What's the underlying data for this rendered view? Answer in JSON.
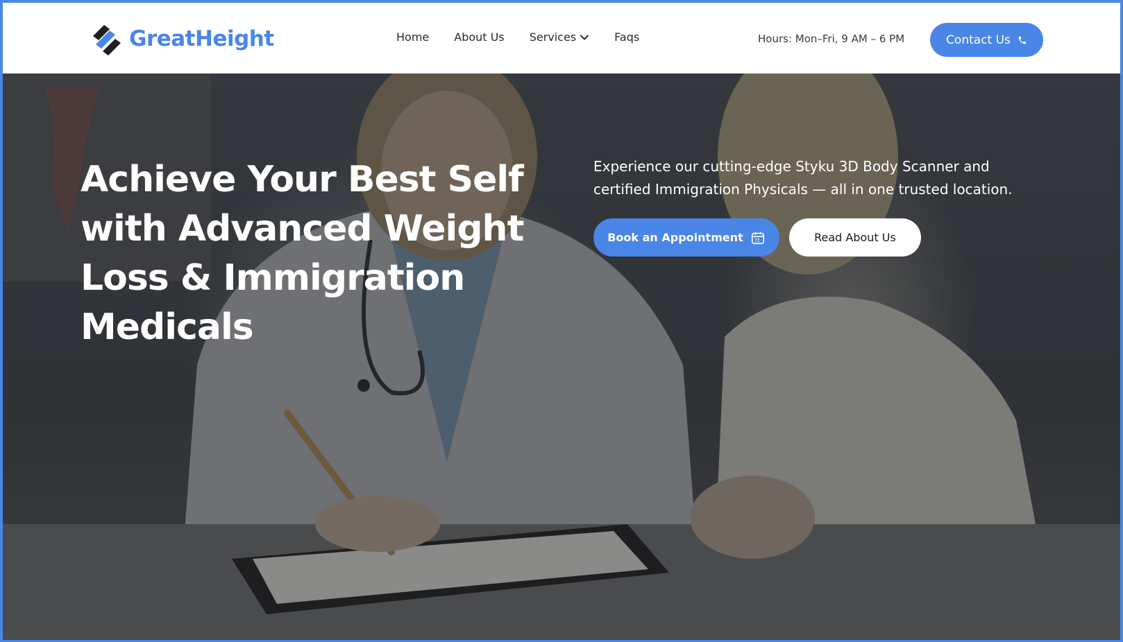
{
  "brand": {
    "name": "GreatHeight",
    "logo_icon": "greatheight-logo-icon",
    "colors": {
      "accent": "#4a86e8",
      "dark": "#1f1f1f"
    }
  },
  "nav": {
    "items": [
      {
        "label": "Home"
      },
      {
        "label": "About Us"
      },
      {
        "label": "Services",
        "icon": "chevron-down-icon"
      },
      {
        "label": "Faqs"
      }
    ]
  },
  "header": {
    "hours": "Hours: Mon–Fri, 9 AM – 6 PM",
    "contact_label": "Contact Us",
    "contact_icon": "phone-icon"
  },
  "hero": {
    "title": "Achieve Your Best Self with Advanced Weight Loss & Immigration Medicals",
    "subtitle": "Experience our cutting-edge Styku 3D Body Scanner and certified Immigration Physicals — all in one trusted location.",
    "primary_cta": "Book an Appointment",
    "primary_cta_icon": "calendar-icon",
    "secondary_cta": "Read About Us",
    "background": "doctor-consultation-photo"
  }
}
